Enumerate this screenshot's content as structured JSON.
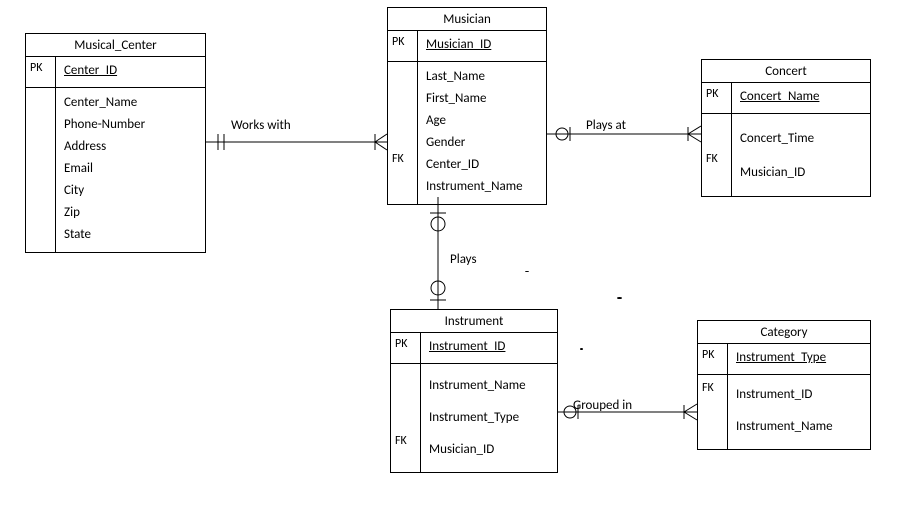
{
  "entities": {
    "musical_center": {
      "title": "Musical_Center",
      "pk_label": "PK",
      "pk_attr": "Center_ID",
      "attrs": [
        "Center_Name",
        "Phone-Number",
        "Address",
        "Email",
        "City",
        "Zip",
        "State"
      ],
      "fk_labels": []
    },
    "musician": {
      "title": "Musician",
      "pk_label": "PK",
      "pk_attr": "Musician_ID",
      "attrs": [
        "Last_Name",
        "First_Name",
        "Age",
        "Gender",
        "Center_ID",
        "Instrument_Name"
      ],
      "fk_labels": [
        {
          "index": 4,
          "label": "FK"
        }
      ]
    },
    "concert": {
      "title": "Concert",
      "pk_label": "PK",
      "pk_attr": "Concert_Name",
      "attrs": [
        "Concert_Time",
        "Musician_ID"
      ],
      "fk_labels": [
        {
          "index": 1,
          "label": "FK"
        }
      ]
    },
    "instrument": {
      "title": "Instrument",
      "pk_label": "PK",
      "pk_attr": "Instrument_ID",
      "attrs": [
        "Instrument_Name",
        "Instrument_Type",
        "Musician_ID"
      ],
      "fk_labels": [
        {
          "index": 2,
          "label": "FK"
        }
      ]
    },
    "category": {
      "title": "Category",
      "pk_label": "PK",
      "pk_attr": "Instrument_Type",
      "attrs": [
        "Instrument_ID",
        "Instrument_Name"
      ],
      "fk_labels": [
        {
          "index": 0,
          "label": "FK"
        }
      ]
    }
  },
  "relationships": {
    "works_with": "Works with",
    "plays_at": "Plays at",
    "plays": "Plays",
    "grouped_in": "Grouped in"
  }
}
